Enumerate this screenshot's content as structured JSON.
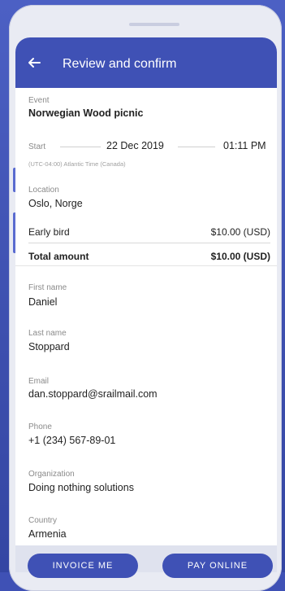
{
  "header": {
    "title": "Review and confirm"
  },
  "event": {
    "label": "Event",
    "name": "Norwegian Wood picnic",
    "start_label": "Start",
    "date": "22 Dec 2019",
    "time": "01:11 PM",
    "timezone": "(UTC-04:00) Atlantic Time (Canada)"
  },
  "location": {
    "label": "Location",
    "value": "Oslo, Norge"
  },
  "tickets": {
    "name": "Early bird",
    "price": "$10.00 (USD)"
  },
  "total": {
    "label": "Total amount",
    "value": "$10.00 (USD)"
  },
  "fields": [
    {
      "label": "First name",
      "value": "Daniel"
    },
    {
      "label": "Last name",
      "value": "Stoppard"
    },
    {
      "label": "Email",
      "value": "dan.stoppard@srailmail.com"
    },
    {
      "label": "Phone",
      "value": "+1 (234) 567-89-01"
    },
    {
      "label": "Organization",
      "value": "Doing nothing solutions"
    },
    {
      "label": "Country",
      "value": "Armenia"
    }
  ],
  "actions": {
    "invoice_label": "INVOICE ME",
    "pay_label": "PAY ONLINE"
  },
  "colors": {
    "primary": "#3f51b5",
    "background": "#ffffff"
  }
}
